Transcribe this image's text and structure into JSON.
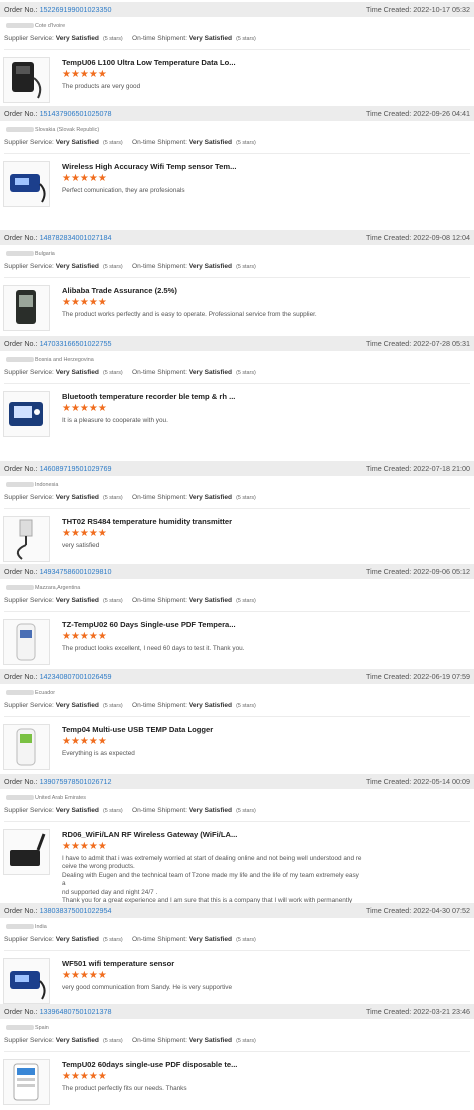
{
  "labels": {
    "order_no": "Order No.:",
    "time_created": "Time Created:",
    "supplier_service": "Supplier Service:",
    "on_time_shipment": "On-time Shipment:",
    "rating_word": "Very Satisfied",
    "stars_text": "(5 stars)",
    "star_glyphs": "★★★★★"
  },
  "colors": {
    "accent": "#f06d1f",
    "link": "#2f7cc7",
    "header_bg": "#ececec"
  },
  "orders": [
    {
      "order_no": "152269199001023350",
      "time": "2022-10-17 05:32",
      "buyer": "Cote d'Ivoire",
      "product": "TempU06 L100 Ultra Low Temperature Data Lo...",
      "review": "The products are very good",
      "rating": 5,
      "thumb": "black-probe-logger"
    },
    {
      "order_no": "151437906501025078",
      "time": "2022-09-26 04:41",
      "buyer": "Slovakia (Slovak Republic)",
      "product": "Wireless High Accuracy Wifi Temp sensor Tem...",
      "review": "Perfect comunication, they are profesionals",
      "rating": 5,
      "thumb": "blue-wifi-sensor"
    },
    {
      "order_no": "148782834001027184",
      "time": "2022-09-08 12:04",
      "buyer": "Bulgaria",
      "product": "Alibaba Trade Assurance (2.5%)",
      "review": "The product works perfectly and is easy to operate. Professional service from the supplier.",
      "rating": 5,
      "thumb": "dark-display-logger"
    },
    {
      "order_no": "147033166501022755",
      "time": "2022-07-28 05:31",
      "buyer": "Bosnia and Herzegovina",
      "product": "Bluetooth temperature recorder ble temp & rh ...",
      "review": "It is a pleasure to cooperate with you.",
      "rating": 5,
      "thumb": "blue-display-recorder"
    },
    {
      "order_no": "146089719501029769",
      "time": "2022-07-18 21:00",
      "buyer": "Indonesia",
      "product": "THT02 RS484 temperature humidity transmitter",
      "review": "very satisfied",
      "rating": 5,
      "thumb": "probe-transmitter"
    },
    {
      "order_no": "149347586001029810",
      "time": "2022-09-06 05:12",
      "buyer": "Mazzara,Argentina",
      "product": "TZ-TempU02 60 Days Single-use PDF Tempera...",
      "review": "The product looks excellent, I need 60 days to test it. Thank you.",
      "rating": 5,
      "thumb": "white-usb-logger"
    },
    {
      "order_no": "142340807001026459",
      "time": "2022-06-19 07:59",
      "buyer": "Ecuador",
      "product": "Temp04 Multi-use USB TEMP Data Logger",
      "review": "Everything is as expected",
      "rating": 5,
      "thumb": "green-usb-logger"
    },
    {
      "order_no": "139075978501026712",
      "time": "2022-05-14 00:09",
      "buyer": "United Arab Emirates",
      "product": "RD06_WiFi/LAN RF Wireless Gateway (WiFi/LA...",
      "review": "I have to admit that i was extremely worried at start of dealing online and not being well understood and re\nceive the wrong products.\nDealing with Eugen and the technical team of Tzone made my life and the life of my team extremely easy a\nnd supported day and night 24/7 .\nThank you for a great experience and I am sure that this is a company that I will work with permanently",
      "rating": 5,
      "thumb": "black-gateway"
    },
    {
      "order_no": "138038375001022954",
      "time": "2022-04-30 07:52",
      "buyer": "India",
      "product": "WF501 wifi temperature sensor",
      "review": "very good communication from Sandy. He is very supportive",
      "rating": 5,
      "thumb": "blue-wifi-sensor"
    },
    {
      "order_no": "133964807501021378",
      "time": "2022-03-21 23:46",
      "buyer": "Spain",
      "product": "TempU02 60days single-use PDF disposable te...",
      "review": "The product perfectly fits our needs. Thanks",
      "rating": 5,
      "thumb": "white-pdf-logger"
    }
  ]
}
